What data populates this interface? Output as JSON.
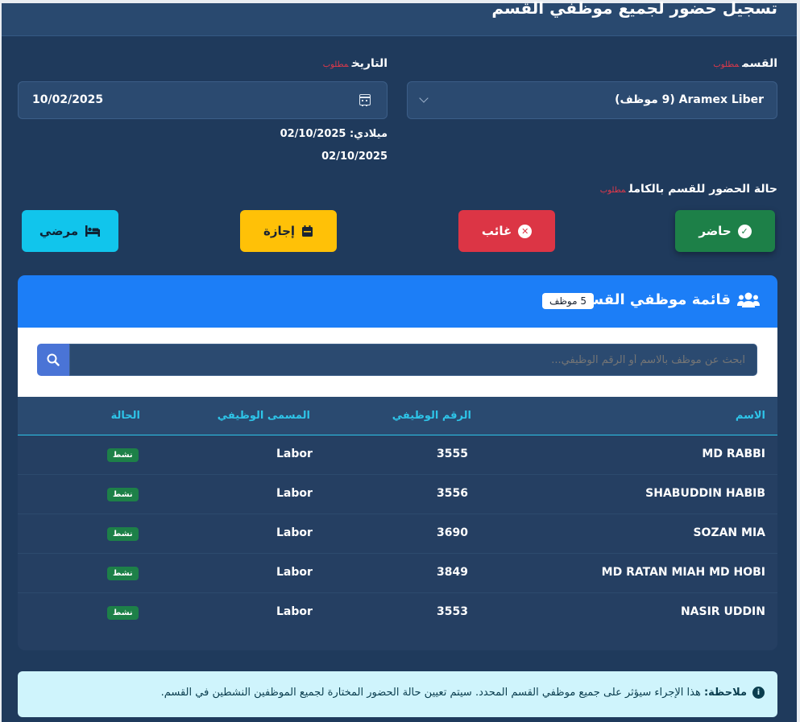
{
  "header": {
    "title": "تسجيل حضور لجميع موظفي القسم"
  },
  "form": {
    "department_label": "القسم",
    "date_label": "التاريخ",
    "required_mark": "مطلوب",
    "department_value": "Aramex Liber (9 موظف)",
    "date_value": "10/02/2025",
    "gregorian_line": "ميلادي: 02/10/2025",
    "date_line2": "02/10/2025"
  },
  "status_section": {
    "label": "حالة الحضور للقسم بالكامل",
    "required_mark": "مطلوب",
    "buttons": {
      "present": "حاضر",
      "absent": "غائب",
      "leave": "إجازة",
      "sick": "مرضي"
    }
  },
  "employees_panel": {
    "title": "قائمة موظفي القسم",
    "count_badge": "5 موظف",
    "search_placeholder": "ابحث عن موظف بالاسم أو الرقم الوظيفي...",
    "columns": {
      "name": "الاسم",
      "employee_number": "الرقم الوظيفي",
      "job_title": "المسمى الوظيفي",
      "status": "الحالة"
    },
    "rows": [
      {
        "name": "MD RABBI",
        "number": "3555",
        "title": "Labor",
        "status": "نشط"
      },
      {
        "name": "SHABUDDIN HABIB",
        "number": "3556",
        "title": "Labor",
        "status": "نشط"
      },
      {
        "name": "SOZAN MIA",
        "number": "3690",
        "title": "Labor",
        "status": "نشط"
      },
      {
        "name": "MD RATAN MIAH MD HOBI",
        "number": "3849",
        "title": "Labor",
        "status": "نشط"
      },
      {
        "name": "NASIR UDDIN",
        "number": "3553",
        "title": "Labor",
        "status": "نشط"
      }
    ]
  },
  "note": {
    "bold": "ملاحظة:",
    "text": " هذا الإجراء سيؤثر على جميع موظفي القسم المحدد. سيتم تعيين حالة الحضور المختارة لجميع الموظفين النشطين في القسم."
  },
  "colors": {
    "background": "#1f3a5c",
    "present": "#1d8048",
    "absent": "#dc3545",
    "leave": "#ffc107",
    "sick": "#11c5ec",
    "panel_header": "#1c7ef7",
    "accent": "#2ec4e8"
  },
  "icons": {
    "present": "check-circle-icon",
    "absent": "x-circle-icon",
    "leave": "calendar-icon",
    "sick": "bed-icon",
    "panel": "users-icon",
    "search": "search-icon",
    "date": "calendar-icon",
    "select": "chevron-down-icon",
    "note": "info-circle-icon"
  }
}
